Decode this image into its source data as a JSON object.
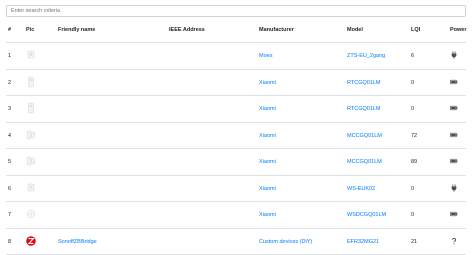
{
  "search": {
    "placeholder": "Enter search criteria"
  },
  "headers": {
    "num": "#",
    "pic": "Pic",
    "name": "Friendly name",
    "ieee": "IEEE Address",
    "manufacturer": "Manufacturer",
    "model": "Model",
    "lqi": "LQI",
    "power": "Power"
  },
  "rows": [
    {
      "num": "1",
      "name": "",
      "ieee": "",
      "manufacturer": "Moes",
      "model": "ZTS-EU_2gang",
      "lqi": "6",
      "power_icon": "plug-icon",
      "pic_icon": "wall-switch-icon"
    },
    {
      "num": "2",
      "name": "",
      "ieee": "",
      "manufacturer": "Xiaomi",
      "model": "RTCGQ01LM",
      "lqi": "0",
      "power_icon": "battery-icon",
      "pic_icon": "motion-sensor-icon"
    },
    {
      "num": "3",
      "name": "",
      "ieee": "",
      "manufacturer": "Xiaomi",
      "model": "RTCGQ01LM",
      "lqi": "0",
      "power_icon": "battery-icon",
      "pic_icon": "motion-sensor-icon"
    },
    {
      "num": "4",
      "name": "",
      "ieee": "",
      "manufacturer": "Xiaomi",
      "model": "MCCGQ01LM",
      "lqi": "72",
      "power_icon": "battery-icon",
      "pic_icon": "door-sensor-icon"
    },
    {
      "num": "5",
      "name": "",
      "ieee": "",
      "manufacturer": "Xiaomi",
      "model": "MCCGQ01LM",
      "lqi": "89",
      "power_icon": "battery-icon",
      "pic_icon": "door-sensor-icon"
    },
    {
      "num": "6",
      "name": "",
      "ieee": "",
      "manufacturer": "Xiaomi",
      "model": "WS-EUK02",
      "lqi": "0",
      "power_icon": "plug-icon",
      "pic_icon": "wall-switch-icon"
    },
    {
      "num": "7",
      "name": "",
      "ieee": "",
      "manufacturer": "Xiaomi",
      "model": "WSDCGQ01LM",
      "lqi": "0",
      "power_icon": "battery-icon",
      "pic_icon": "temperature-sensor-icon"
    },
    {
      "num": "8",
      "name": "SonoffZBBridge",
      "ieee": "",
      "manufacturer": "Custom devices (DiY)",
      "model": "EFR32MG21",
      "lqi": "21",
      "power_icon": "question-icon",
      "pic_icon": "zigbee-logo-icon"
    }
  ],
  "colors": {
    "link": "#007bff",
    "border": "#dee2e6",
    "zigbee_red": "#e30613"
  }
}
